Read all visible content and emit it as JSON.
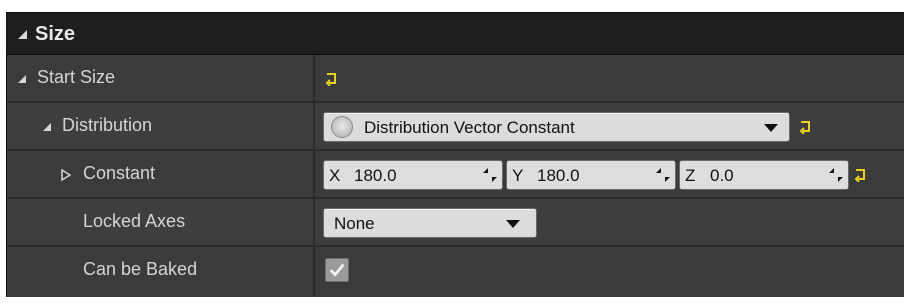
{
  "header": {
    "title": "Size"
  },
  "rows": [
    {
      "label": "Start Size"
    },
    {
      "label": "Distribution"
    },
    {
      "label": "Constant"
    },
    {
      "label": "Locked Axes"
    },
    {
      "label": "Can be Baked"
    }
  ],
  "distribution": {
    "value": "Distribution Vector Constant"
  },
  "constant": {
    "x": {
      "axis": "X",
      "value": "180.0"
    },
    "y": {
      "axis": "Y",
      "value": "180.0"
    },
    "z": {
      "axis": "Z",
      "value": "0.0"
    }
  },
  "locked_axes": {
    "value": "None"
  },
  "can_be_baked": {
    "checked": true
  },
  "icons": {
    "reset": "reset-to-default-icon",
    "expand": "triangle-down-icon",
    "collapsed": "triangle-right-icon",
    "spin": "drag-spin-icon",
    "check": "check-icon"
  },
  "colors": {
    "reset_icon": "#e8d21d",
    "panel_bg": "#2f2f2f",
    "header_bg": "#1e1e1e",
    "row_bg": "#3b3b3b"
  }
}
